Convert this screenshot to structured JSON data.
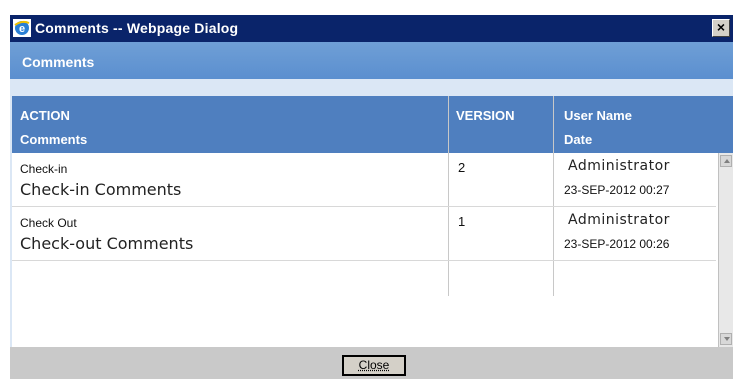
{
  "window": {
    "title": "Comments -- Webpage Dialog",
    "close_glyph": "×"
  },
  "section": {
    "title": "Comments"
  },
  "table": {
    "headers": {
      "action": "ACTION",
      "comments": "Comments",
      "version": "VERSION",
      "user_name": "User Name",
      "date": "Date"
    },
    "rows": [
      {
        "action": "Check-in",
        "comment": "Check-in Comments",
        "version": "2",
        "user": "Administrator",
        "date": "23-SEP-2012 00:27"
      },
      {
        "action": "Check Out",
        "comment": "Check-out Comments",
        "version": "1",
        "user": "Administrator",
        "date": "23-SEP-2012 00:26"
      }
    ]
  },
  "footer": {
    "close_label": "Close"
  },
  "colors": {
    "titlebar": "#0a246a",
    "section_header": "#5b8fcf",
    "table_header": "#4f7fbf",
    "footer": "#c9c9c9"
  }
}
